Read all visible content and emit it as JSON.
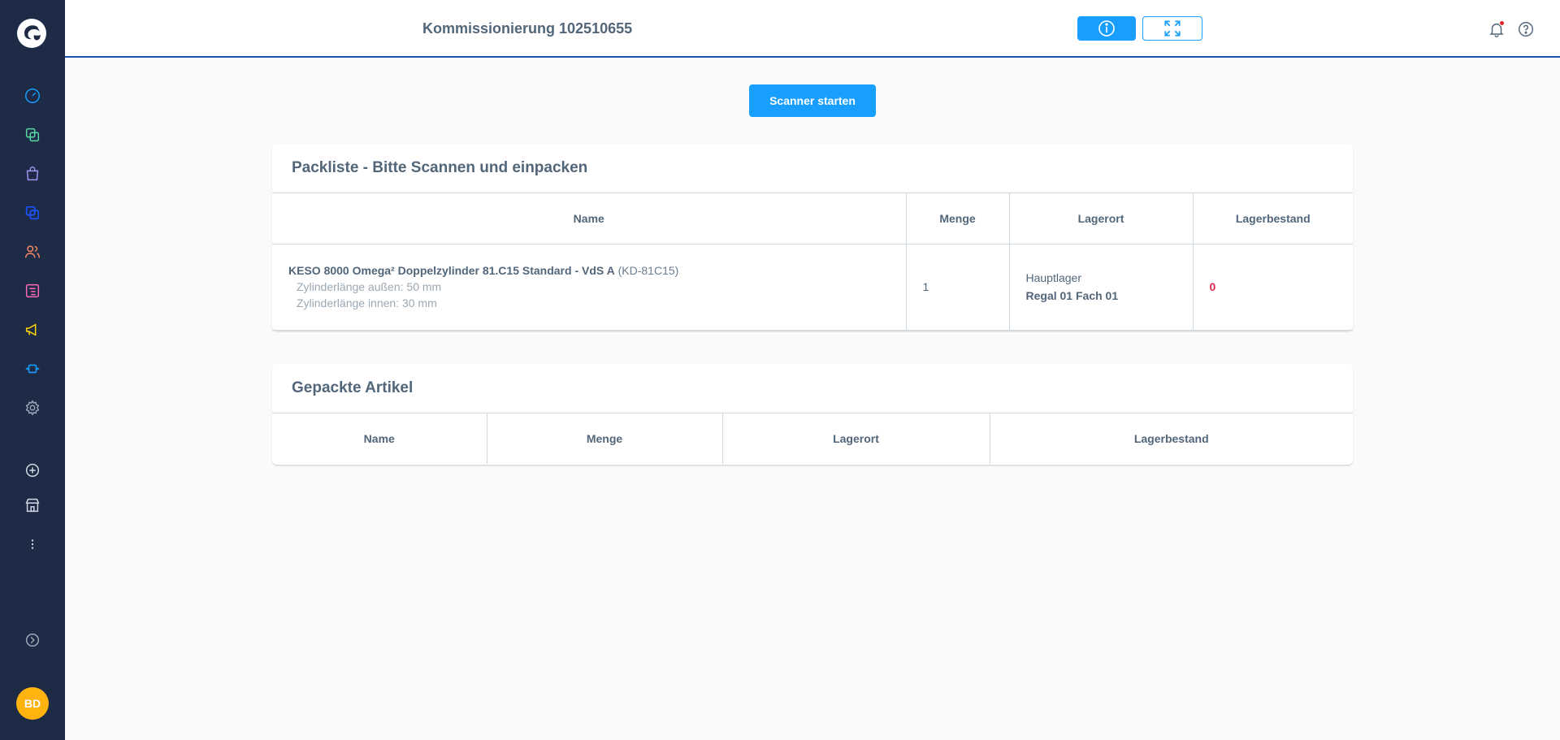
{
  "header": {
    "title": "Kommissionierung 102510655"
  },
  "user": {
    "initials": "BD"
  },
  "actions": {
    "scan_button": "Scanner starten"
  },
  "packlist": {
    "title": "Packliste - Bitte Scannen und einpacken",
    "columns": [
      "Name",
      "Menge",
      "Lagerort",
      "Lagerbestand"
    ],
    "rows": [
      {
        "name": "KESO 8000 Omega² Doppelzylinder 81.C15 Standard - VdS A",
        "sku": "(KD-81C15)",
        "options": [
          "Zylinderlänge außen: 50 mm",
          "Zylinderlänge innen: 30 mm"
        ],
        "quantity": "1",
        "location_main": "Hauptlager",
        "location_sub": "Regal 01 Fach 01",
        "stock": "0"
      }
    ]
  },
  "packed": {
    "title": "Gepackte Artikel",
    "columns": [
      "Name",
      "Menge",
      "Lagerort",
      "Lagerbestand"
    ]
  },
  "colors": {
    "sidebar": "#1e2b47",
    "accent": "#189eff",
    "danger": "#de294c"
  }
}
